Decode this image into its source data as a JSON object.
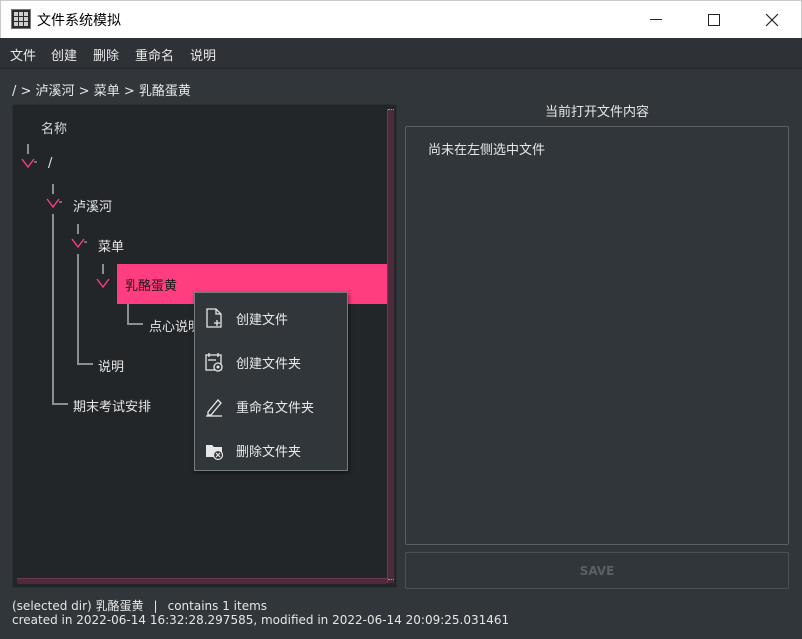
{
  "window": {
    "title": "文件系统模拟",
    "minimize_icon": "minimize-icon",
    "maximize_icon": "maximize-icon",
    "close_icon": "close-icon"
  },
  "menubar": {
    "items": [
      "文件",
      "创建",
      "删除",
      "重命名",
      "说明"
    ]
  },
  "breadcrumb": "/ > 泸溪河 > 菜单 > 乳酪蛋黄",
  "tree": {
    "header": "名称",
    "nodes": [
      {
        "label": "/",
        "expanded": true,
        "depth": 0
      },
      {
        "label": "泸溪河",
        "expanded": true,
        "depth": 1
      },
      {
        "label": "菜单",
        "expanded": true,
        "depth": 2
      },
      {
        "label": "乳酪蛋黄",
        "expanded": true,
        "depth": 3,
        "selected": true
      },
      {
        "label": "点心说明",
        "depth": 4
      },
      {
        "label": "说明",
        "depth": 3
      },
      {
        "label": "期末考试安排",
        "depth": 2
      }
    ],
    "selected_color": "#ff3d7f",
    "expander_icon": "chevron-down-icon"
  },
  "context_menu": {
    "items": [
      {
        "label": "创建文件",
        "icon": "new-file-icon"
      },
      {
        "label": "创建文件夹",
        "icon": "new-folder-icon"
      },
      {
        "label": "重命名文件夹",
        "icon": "rename-pencil-icon"
      },
      {
        "label": "删除文件夹",
        "icon": "delete-folder-icon"
      }
    ]
  },
  "content_panel": {
    "title": "当前打开文件内容",
    "placeholder": "尚未在左侧选中文件",
    "save_label": "SAVE"
  },
  "status": {
    "selected": "(selected dir) 乳酪蛋黄",
    "separator": "|",
    "count": "contains 1 items",
    "dates": "created in 2022-06-14 16:32:28.297585, modified in 2022-06-14 20:09:25.031461"
  },
  "colors": {
    "accent": "#ff3d7f",
    "background": "#31363b",
    "panel": "#232629"
  }
}
